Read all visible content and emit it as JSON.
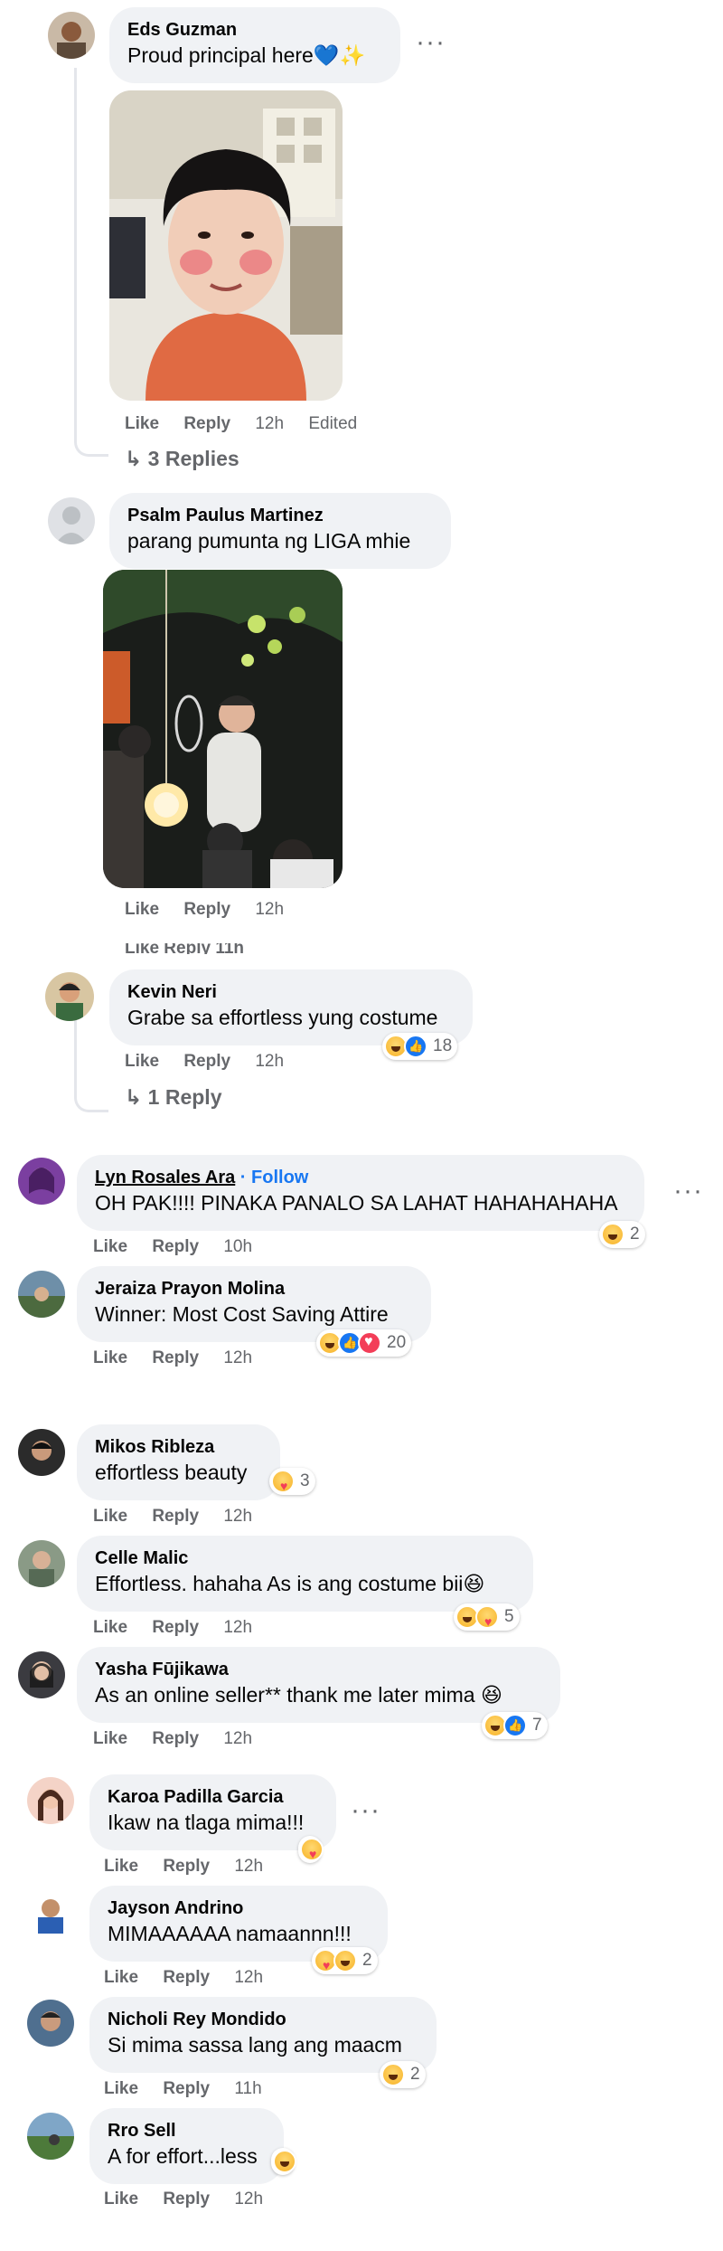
{
  "comments": [
    {
      "name": "Eds Guzman",
      "text": "Proud principal here💙✨",
      "time": "12h",
      "edited": "Edited",
      "replies": "3 Replies"
    },
    {
      "name": "Psalm Paulus Martinez",
      "text": "parang pumunta ng LIGA mhie",
      "time": "12h",
      "partial_actions": "Like  Reply  11h"
    },
    {
      "name": "Kevin Neri",
      "text": "Grabe sa effortless yung costume",
      "time": "12h",
      "reactions": "18",
      "replies": "1 Reply"
    },
    {
      "name": "Lyn Rosales Ara",
      "follow": " · Follow",
      "text": "OH PAK!!!! PINAKA PANALO SA LAHAT HAHAHAHAHA",
      "time": "10h",
      "reactions": "2"
    },
    {
      "name": "Jeraiza Prayon Molina",
      "text": "Winner: Most Cost Saving Attire",
      "time": "12h",
      "reactions": "20"
    },
    {
      "name": "Mikos Ribleza",
      "text": "effortless beauty",
      "time": "12h",
      "reactions": "3"
    },
    {
      "name": "Celle Malic",
      "text": "Effortless. hahaha As is ang costume bii😆",
      "time": "12h",
      "reactions": "5"
    },
    {
      "name": "Yasha Fūjikawa",
      "text": "As an online seller** thank me later mima 😆",
      "time": "12h",
      "reactions": "7"
    },
    {
      "name": "Karoa Padilla Garcia",
      "text": "Ikaw na tlaga mima!!!",
      "time": "12h"
    },
    {
      "name": "Jayson Andrino",
      "text": "MIMAAAAAA namaannn!!!",
      "time": "12h",
      "reactions": "2"
    },
    {
      "name": "Nicholi Rey Mondido",
      "text": "Si mima sassa lang ang maacm",
      "time": "11h",
      "reactions": "2"
    },
    {
      "name": "Rro Sell",
      "text": "A for effort...less",
      "time": "12h"
    }
  ],
  "actions": {
    "like": "Like",
    "reply": "Reply"
  },
  "icons": {
    "more": "more-options-icon",
    "reply_arrow": "reply-arrow-icon"
  },
  "colors": {
    "bubble": "#f0f2f5",
    "meta": "#65676b",
    "link": "#1877f2"
  }
}
